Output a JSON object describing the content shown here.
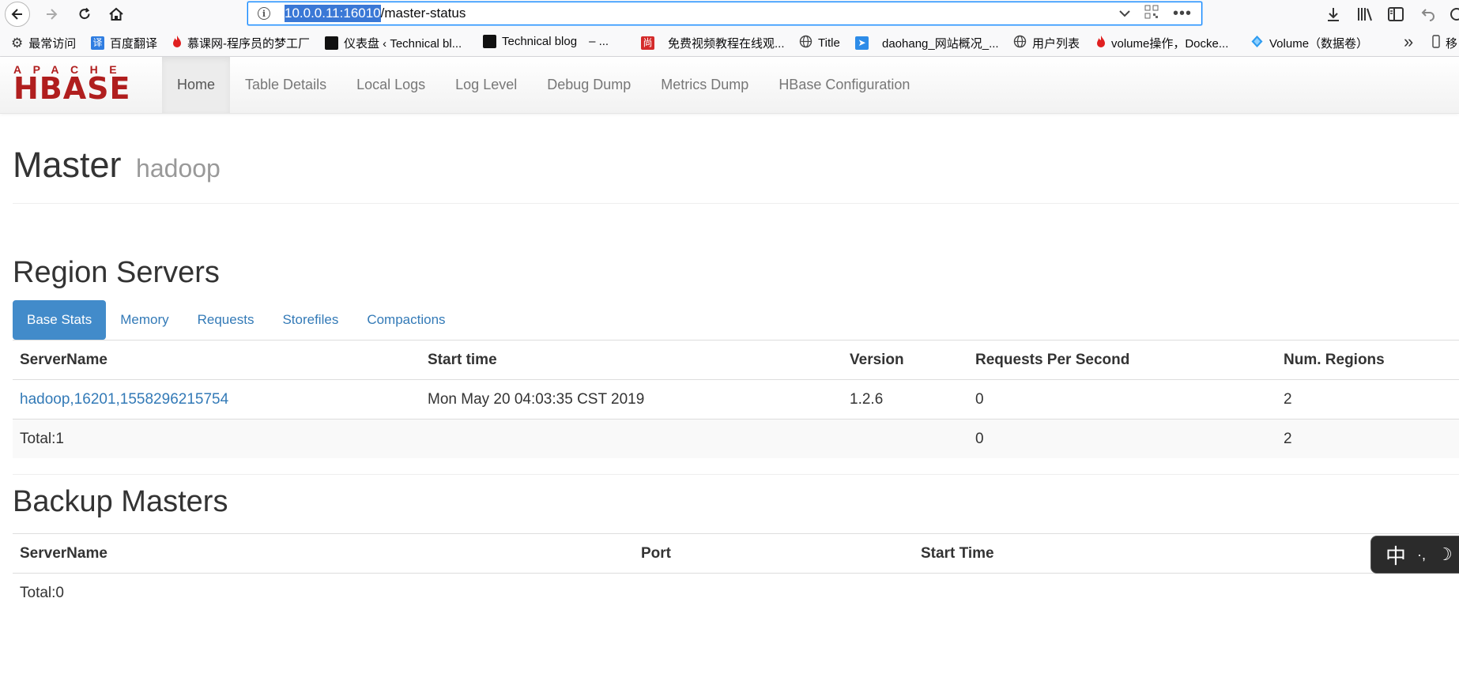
{
  "browser": {
    "url_host": "10.0.0.11:16010",
    "url_path": "/master-status",
    "bookmarks": [
      {
        "label": "最常访问",
        "icon": "gear-icon"
      },
      {
        "label": "百度翻译",
        "icon": "translate-icon"
      },
      {
        "label": "慕课网-程序员的梦工厂",
        "icon": "flame-icon"
      },
      {
        "label": "仪表盘 ‹ Technical bl...",
        "icon": "dark-site-icon"
      },
      {
        "label": "Technical blog",
        "icon": "dark-site-icon"
      },
      {
        "label": "免费视频教程在线观...",
        "icon": "red-site-icon"
      },
      {
        "label": "Title",
        "icon": "globe-icon"
      },
      {
        "label": "daohang_网站概况_...",
        "icon": "send-icon"
      },
      {
        "label": "用户列表",
        "icon": "globe-icon"
      },
      {
        "label": "volume操作，Docke...",
        "icon": "flame-icon"
      },
      {
        "label": "Volume（数据卷）",
        "icon": "diamond-icon"
      },
      {
        "label": "移",
        "icon": "phone-icon"
      }
    ],
    "bookmark_extra": "– ..."
  },
  "hbase": {
    "logo_top": "APACHE",
    "logo_main": "HBASE",
    "nav": [
      "Home",
      "Table Details",
      "Local Logs",
      "Log Level",
      "Debug Dump",
      "Metrics Dump",
      "HBase Configuration"
    ]
  },
  "header": {
    "title": "Master",
    "host": "hadoop"
  },
  "region_servers": {
    "heading": "Region Servers",
    "tabs": [
      "Base Stats",
      "Memory",
      "Requests",
      "Storefiles",
      "Compactions"
    ],
    "columns": [
      "ServerName",
      "Start time",
      "Version",
      "Requests Per Second",
      "Num. Regions"
    ],
    "rows": [
      [
        "hadoop,16201,1558296215754",
        "Mon May 20 04:03:35 CST 2019",
        "1.2.6",
        "0",
        "2"
      ]
    ],
    "total": [
      "Total:1",
      "",
      "",
      "0",
      "2"
    ]
  },
  "backup_masters": {
    "heading": "Backup Masters",
    "columns": [
      "ServerName",
      "Port",
      "Start Time"
    ],
    "total": "Total:0"
  },
  "ime": {
    "label": "中",
    "punct": "·,",
    "mode": "☽"
  }
}
